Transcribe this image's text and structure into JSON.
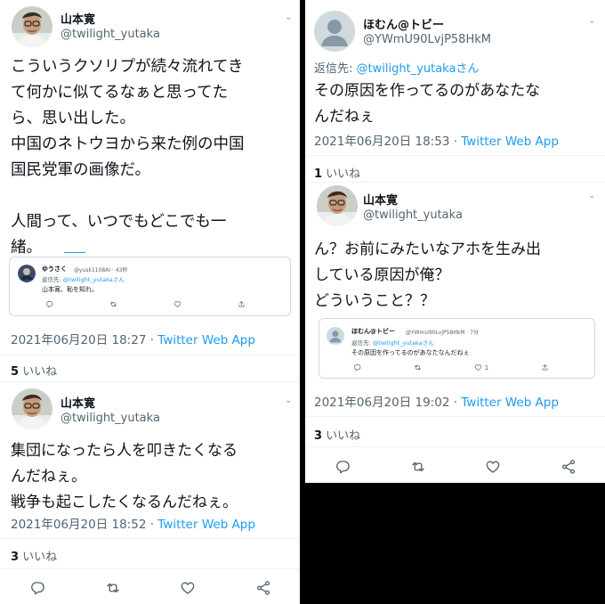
{
  "left": {
    "tweet1": {
      "name": "山本寛",
      "handle": "@twilight_yutaka",
      "body": "こういうクソリプが続々流れてき\nて何かに似てるなぁと思ってた\nら、思い出した。\n中国のネトウヨから来た例の中国\n国民党軍の画像だ。\n\n人間って、いつでもどこでも一\n緒。",
      "quote": {
        "name": "ゆうさく",
        "handle": "@yusk1108AI · 43秒",
        "reply_prefix": "返信先: ",
        "reply_to": "@twilight_yutakaさん",
        "text": "山本寛、恥を知れ。"
      },
      "date": "2021年06月20日 18:27 · ",
      "source": "Twitter Web App",
      "likes_count": "5",
      "likes_label": " いいね"
    },
    "tweet2": {
      "name": "山本寛",
      "handle": "@twilight_yutaka",
      "body": "集団になったら人を叩きたくなる\nんだねぇ。\n戦争も起こしたくなるんだねぇ。",
      "date": "2021年06月20日 18:52 · ",
      "source": "Twitter Web App",
      "likes_count": "3",
      "likes_label": " いいね"
    }
  },
  "right": {
    "tweet1": {
      "name": "ほむん@トビー",
      "handle": "@YWmU90LvjP58HkM",
      "reply_prefix": "返信先: ",
      "reply_to": "@twilight_yutakaさん",
      "body": "その原因を作ってるのがあなたな\nんだねぇ",
      "date": "2021年06月20日 18:53 · ",
      "source": "Twitter Web App",
      "likes_count": "1",
      "likes_label": " いいね"
    },
    "tweet2": {
      "name": "山本寛",
      "handle": "@twilight_yutaka",
      "body": "ん？お前にみたいなアホを生み出\nしている原因が俺？\nどういうこと？？",
      "quote": {
        "name": "ほむん@トビー",
        "handle": "@YWmU90LvjP58HkM · 7分",
        "reply_prefix": "返信先: ",
        "reply_to": "@twilight_yutakaさん",
        "text": "その原因を作ってるのがあなたなんだねぇ",
        "like_count": "1"
      },
      "date": "2021年06月20日 19:02 · ",
      "source": "Twitter Web App",
      "likes_count": "3",
      "likes_label": " いいね"
    }
  },
  "colors": {
    "accent": "#1d9bf0",
    "muted": "#536471",
    "text": "#0f1419"
  },
  "icons": [
    "reply-icon",
    "retweet-icon",
    "like-icon",
    "share-icon",
    "chevron-down-icon"
  ]
}
